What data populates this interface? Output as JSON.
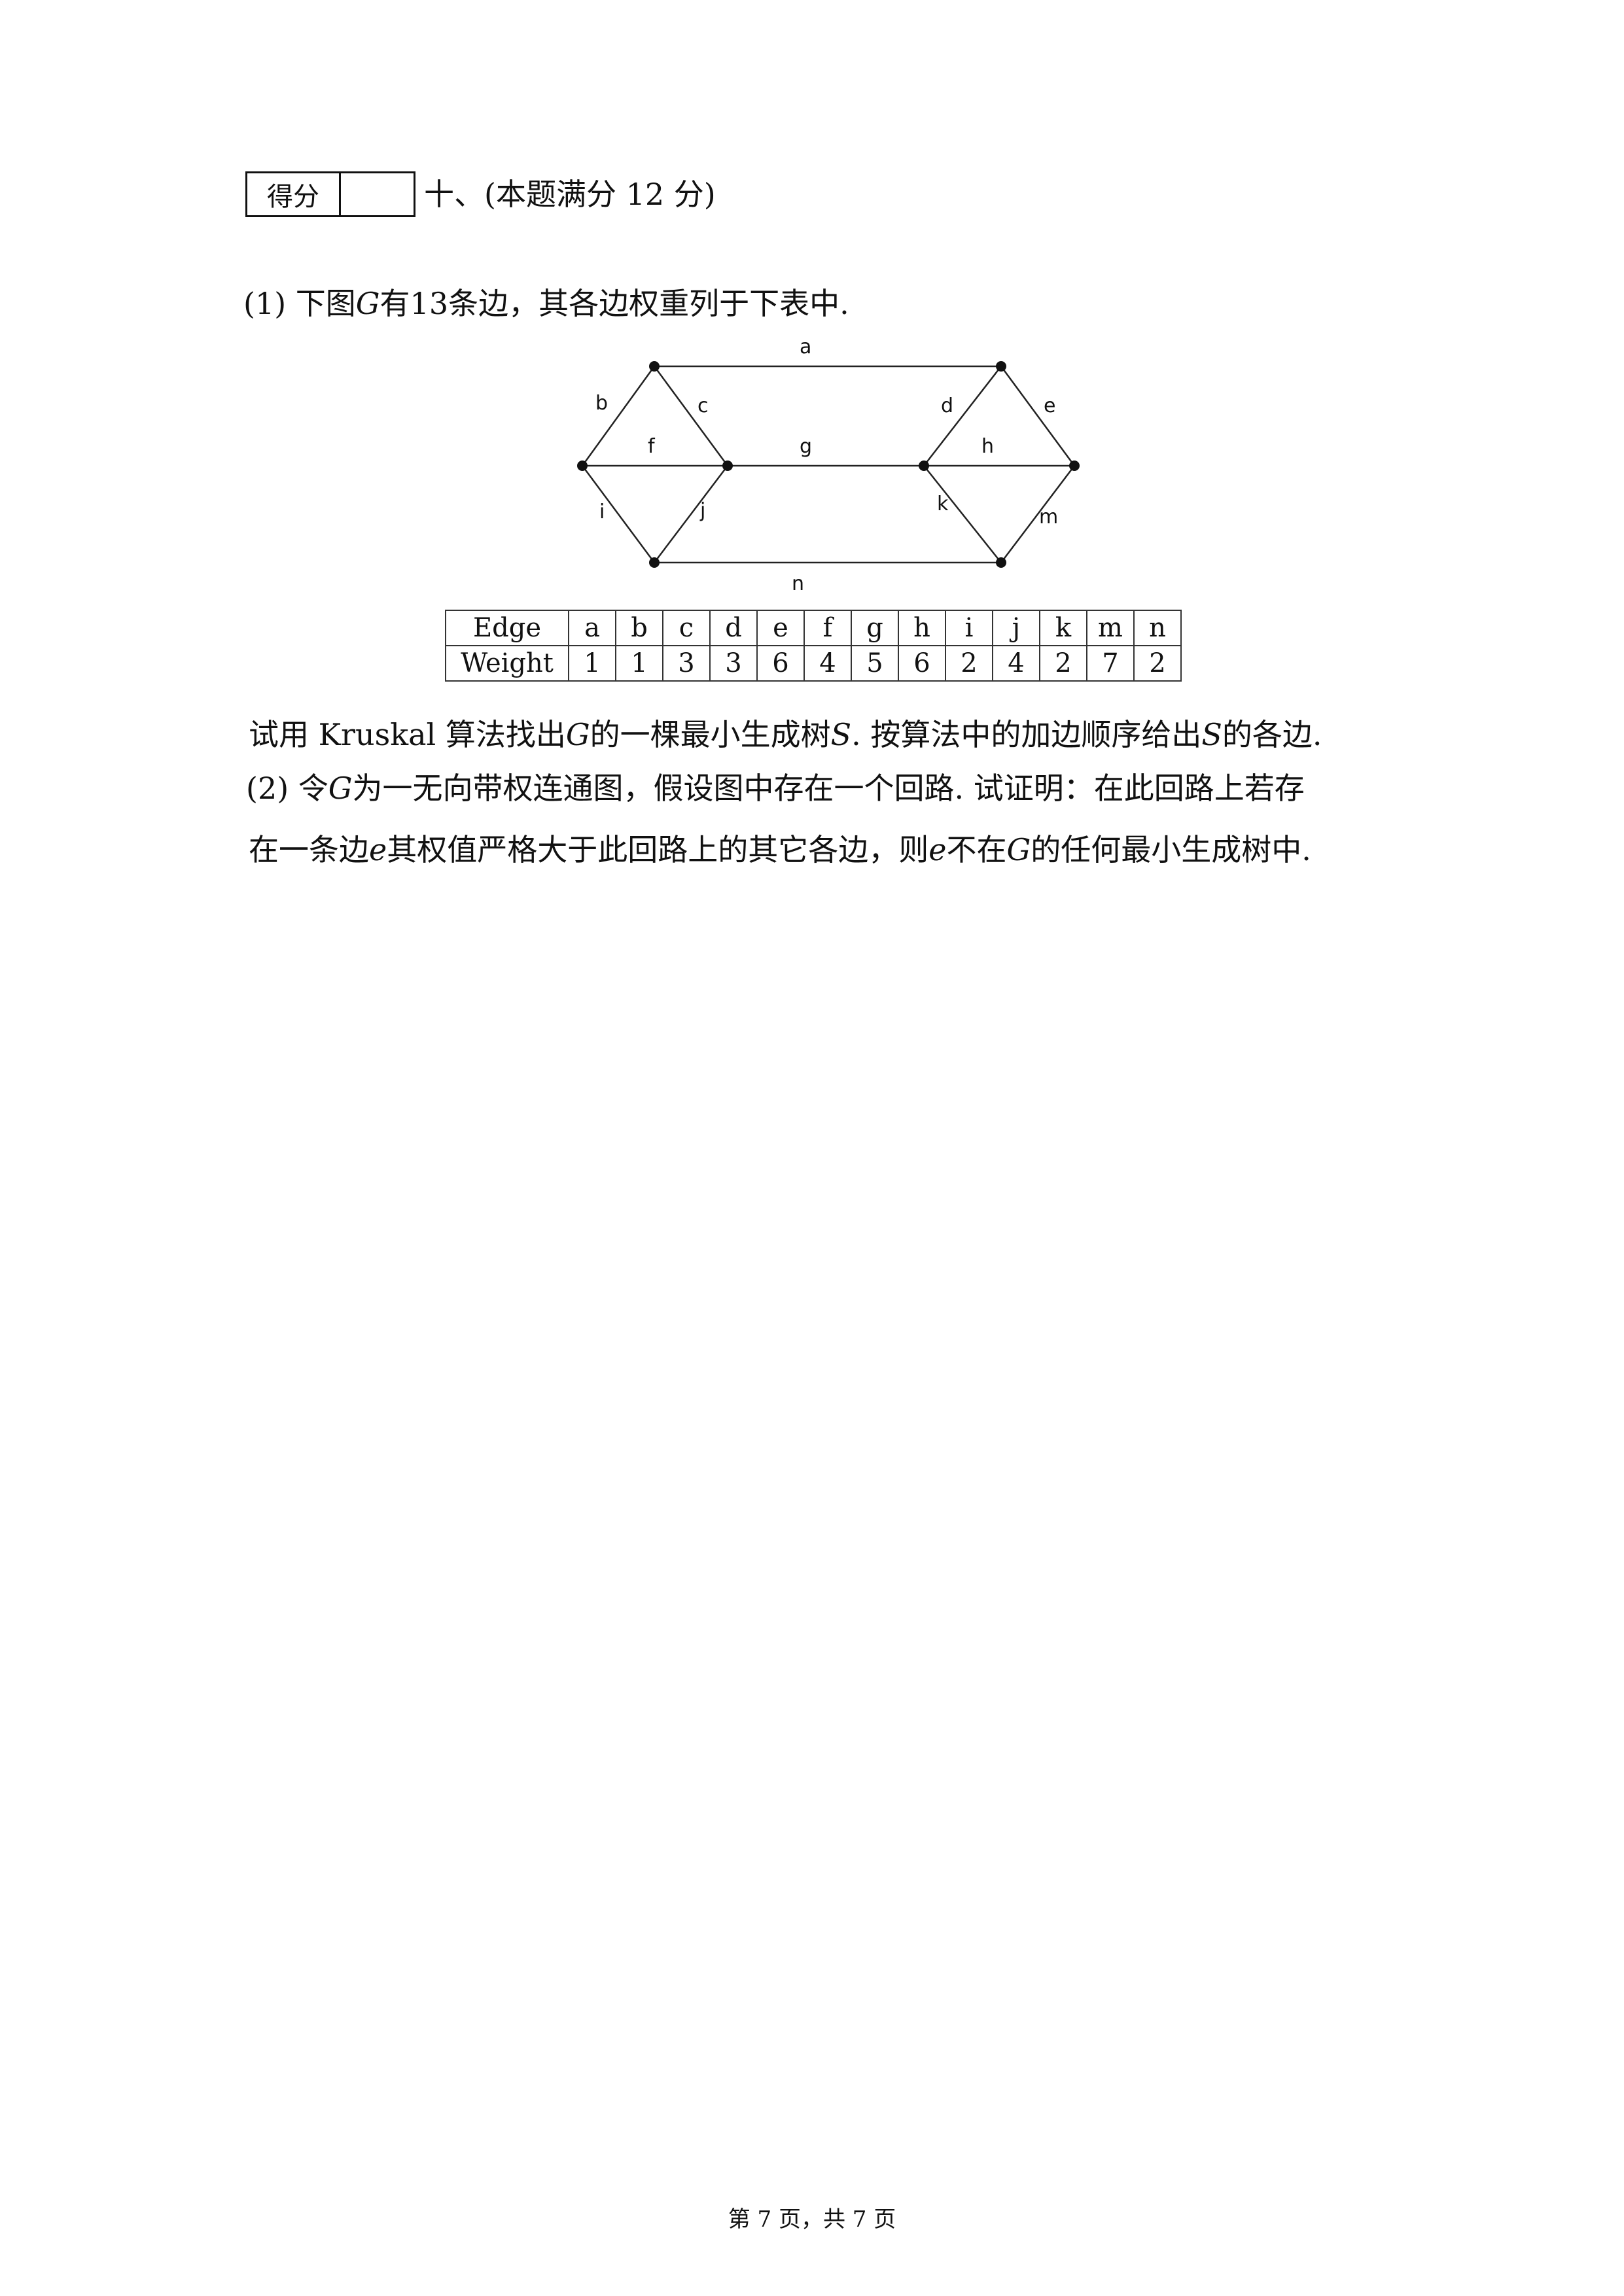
{
  "header": {
    "score_label": "得分",
    "score_value": "",
    "question_title": "十、(本题满分 12 分)"
  },
  "part1": {
    "number": "(1)",
    "text_before": "下图",
    "graph_name": "G",
    "text_after": "有13条边，其各边权重列于下表中."
  },
  "graph": {
    "edge_labels": {
      "a": "a",
      "b": "b",
      "c": "c",
      "d": "d",
      "e": "e",
      "f": "f",
      "g": "g",
      "h": "h",
      "i": "i",
      "j": "j",
      "k": "k",
      "m": "m",
      "n": "n"
    }
  },
  "table": {
    "row1_header": "Edge",
    "row2_header": "Weight",
    "edges": [
      "a",
      "b",
      "c",
      "d",
      "e",
      "f",
      "g",
      "h",
      "i",
      "j",
      "k",
      "m",
      "n"
    ],
    "weights": [
      "1",
      "1",
      "3",
      "3",
      "6",
      "4",
      "5",
      "6",
      "2",
      "4",
      "2",
      "7",
      "2"
    ]
  },
  "instruction": {
    "t1": "试用 Kruskal 算法找出",
    "g": "G",
    "t2": "的一棵最小生成树",
    "s": "S",
    "t3": ". 按算法中的加边顺序给出",
    "s2": "S",
    "t4": "的各边."
  },
  "part2": {
    "number": "(2)",
    "l1_t1": "令",
    "l1_g": "G",
    "l1_t2": "为一无向带权连通图，假设图中存在一个回路. 试证明：在此回路上若存",
    "l2_t1": "在一条边",
    "l2_e": "e",
    "l2_t2": "其权值严格大于此回路上的其它各边，则",
    "l2_e2": "e",
    "l2_t3": "不在",
    "l2_g": "G",
    "l2_t4": "的任何最小生成树中."
  },
  "footer": {
    "text": "第 7 页，共 7 页"
  }
}
